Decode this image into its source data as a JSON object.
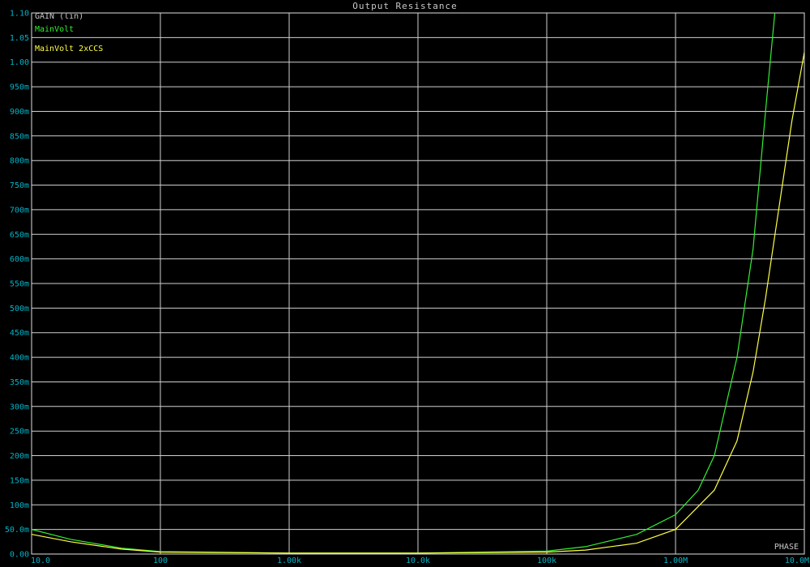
{
  "chart_data": {
    "type": "line",
    "title": "Output Resistance",
    "y_axis_label": "GAIN (lin)",
    "corner_label": "PHASE",
    "x_scale": "log",
    "xlim": [
      10,
      10000000
    ],
    "ylim": [
      0,
      1.1
    ],
    "grid": true,
    "x_tick_values": [
      10,
      100,
      1000,
      10000,
      100000,
      1000000,
      10000000
    ],
    "x_tick_labels": [
      "10.0",
      "100",
      "1.00k",
      "10.0k",
      "100k",
      "1.00M",
      "10.0M"
    ],
    "y_tick_values": [
      0,
      0.05,
      0.1,
      0.15,
      0.2,
      0.25,
      0.3,
      0.35,
      0.4,
      0.45,
      0.5,
      0.55,
      0.6,
      0.65,
      0.7,
      0.75,
      0.8,
      0.85,
      0.9,
      0.95,
      1.0,
      1.05,
      1.1
    ],
    "y_tick_labels": [
      "0.00",
      "50.0m",
      "100m",
      "150m",
      "200m",
      "250m",
      "300m",
      "350m",
      "400m",
      "450m",
      "500m",
      "550m",
      "600m",
      "650m",
      "700m",
      "750m",
      "800m",
      "850m",
      "900m",
      "950m",
      "1.00",
      "1.05",
      "1.10"
    ],
    "series": [
      {
        "name": "MainVolt",
        "color": "#33ee33",
        "x": [
          10,
          20,
          50,
          100,
          1000,
          10000,
          100000,
          200000,
          500000,
          1000000,
          1500000,
          2000000,
          3000000,
          4000000,
          5000000,
          6000000
        ],
        "y": [
          0.05,
          0.03,
          0.012,
          0.005,
          0.002,
          0.002,
          0.006,
          0.015,
          0.04,
          0.08,
          0.13,
          0.2,
          0.4,
          0.62,
          0.9,
          1.12
        ]
      },
      {
        "name": "MainVolt 2xCCS",
        "color": "#ffff44",
        "x": [
          10,
          20,
          50,
          100,
          1000,
          10000,
          100000,
          200000,
          500000,
          1000000,
          2000000,
          3000000,
          4000000,
          5000000,
          6000000,
          8000000,
          10000000
        ],
        "y": [
          0.04,
          0.025,
          0.01,
          0.004,
          0.002,
          0.002,
          0.004,
          0.008,
          0.022,
          0.05,
          0.13,
          0.23,
          0.37,
          0.52,
          0.66,
          0.88,
          1.02
        ]
      }
    ]
  }
}
